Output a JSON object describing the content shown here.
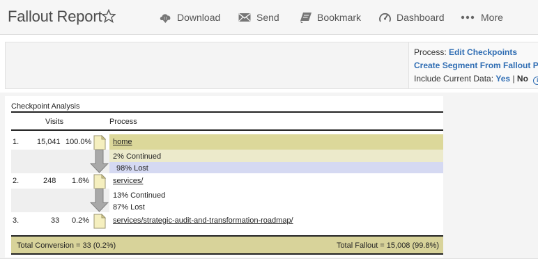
{
  "header": {
    "title": "Fallout Report",
    "actions": [
      {
        "label": "Download",
        "icon": "download-icon"
      },
      {
        "label": "Send",
        "icon": "send-icon"
      },
      {
        "label": "Bookmark",
        "icon": "bookmark-icon"
      },
      {
        "label": "Dashboard",
        "icon": "dashboard-icon"
      },
      {
        "label": "More",
        "icon": "more-icon"
      }
    ]
  },
  "panel": {
    "process_label": "Process:",
    "edit_checkpoints": "Edit Checkpoints",
    "create_segment": "Create Segment From Fallout Path",
    "include_label": "Include Current Data:",
    "yes": "Yes",
    "separator": "|",
    "no": "No",
    "info_glyph": "i"
  },
  "report": {
    "title": "Checkpoint Analysis",
    "col_visits": "Visits",
    "col_process": "Process",
    "checkpoints": [
      {
        "index": "1.",
        "visits": "15,041",
        "percent": "100.0%",
        "page": "home",
        "continued": "2% Continued",
        "lost": "98% Lost"
      },
      {
        "index": "2.",
        "visits": "248",
        "percent": "1.6%",
        "page": "services/",
        "continued": "13% Continued",
        "lost": "87% Lost"
      },
      {
        "index": "3.",
        "visits": "33",
        "percent": "0.2%",
        "page": "services/strategic-audit-and-transformation-roadmap/"
      }
    ],
    "continued_fractions": [
      0.02,
      0.13
    ],
    "lost_fractions": [
      0.98,
      0.87
    ],
    "total_conversion": "Total Conversion = 33 (0.2%)",
    "total_fallout": "Total Fallout = 15,008 (99.8%)"
  },
  "colors": {
    "checkpoint_band": "#dcd89a",
    "continued_band": "#eceacb",
    "lost_band": "#d5d9f2",
    "link": "#2f6db3"
  }
}
